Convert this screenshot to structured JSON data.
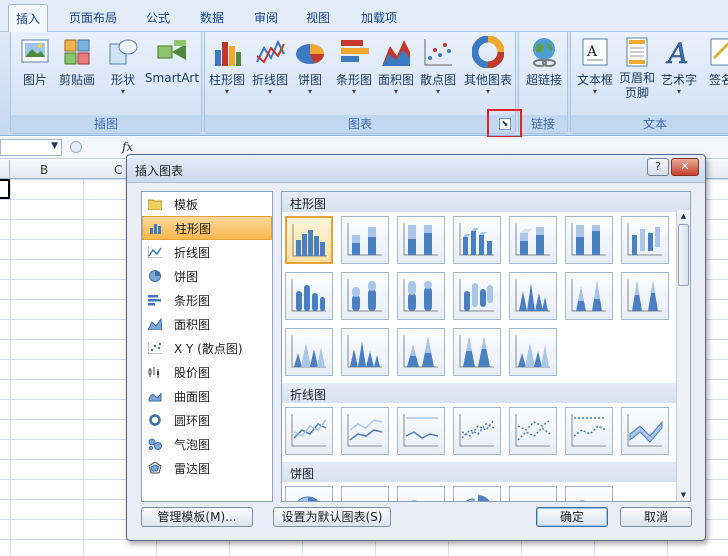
{
  "tabs": [
    {
      "label": "插入",
      "active": true
    },
    {
      "label": "页面布局"
    },
    {
      "label": "公式"
    },
    {
      "label": "数据"
    },
    {
      "label": "审阅"
    },
    {
      "label": "视图"
    },
    {
      "label": "加载项"
    }
  ],
  "ribbon": {
    "groups": {
      "illustrations": "插图",
      "charts": "图表",
      "links": "链接",
      "text": "文本"
    },
    "buttons": {
      "picture": "图片",
      "clipart": "剪贴画",
      "shapes": "形状",
      "smartart": "SmartArt",
      "column": "柱形图",
      "line": "折线图",
      "pie": "饼图",
      "bar": "条形图",
      "area": "面积图",
      "scatter": "散点图",
      "other": "其他图表",
      "hyperlink": "超链接",
      "textbox": "文本框",
      "header_footer": "页眉和页脚",
      "wordart": "艺术字",
      "signature": "签名"
    }
  },
  "formula_bar": {
    "fx": "fx"
  },
  "sheet": {
    "columns": [
      "B",
      "C"
    ]
  },
  "dialog": {
    "title": "插入图表",
    "help": "?",
    "close": "✕",
    "categories": [
      {
        "label": "模板",
        "icon": "folder-icon"
      },
      {
        "label": "柱形图",
        "icon": "column-chart-icon",
        "selected": true
      },
      {
        "label": "折线图",
        "icon": "line-chart-icon"
      },
      {
        "label": "饼图",
        "icon": "pie-chart-icon"
      },
      {
        "label": "条形图",
        "icon": "bar-chart-icon"
      },
      {
        "label": "面积图",
        "icon": "area-chart-icon"
      },
      {
        "label": "X Y (散点图)",
        "icon": "scatter-chart-icon"
      },
      {
        "label": "股价图",
        "icon": "stock-chart-icon"
      },
      {
        "label": "曲面图",
        "icon": "surface-chart-icon"
      },
      {
        "label": "圆环图",
        "icon": "doughnut-chart-icon"
      },
      {
        "label": "气泡图",
        "icon": "bubble-chart-icon"
      },
      {
        "label": "雷达图",
        "icon": "radar-chart-icon"
      }
    ],
    "sections": {
      "column": "柱形图",
      "line": "折线图",
      "pie": "饼图"
    },
    "buttons": {
      "manage": "管理模板(M)...",
      "set_default": "设置为默认图表(S)",
      "ok": "确定",
      "cancel": "取消"
    }
  },
  "colors": {
    "accent": "#4a7fc1",
    "highlight": "#f8b84a",
    "callout": "#e02424"
  }
}
